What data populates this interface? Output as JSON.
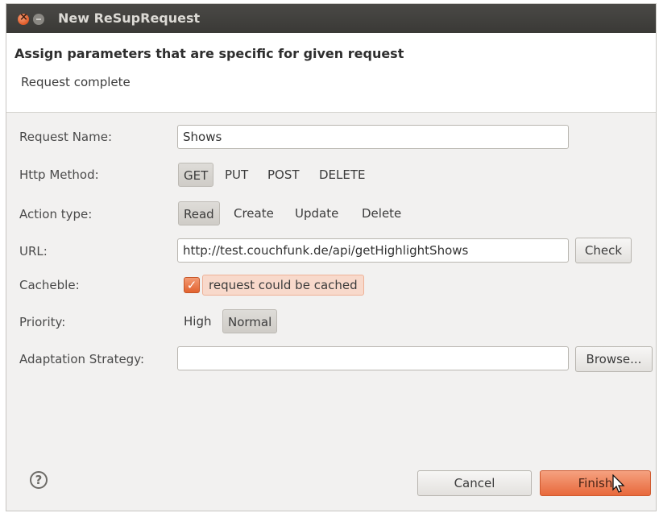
{
  "window": {
    "title": "New ReSupRequest"
  },
  "banner": {
    "title": "Assign parameters that are specific for given request",
    "message": "Request complete"
  },
  "form": {
    "request_name": {
      "label": "Request Name:",
      "value": "Shows"
    },
    "http_method": {
      "label": "Http Method:",
      "options": [
        "GET",
        "PUT",
        "POST",
        "DELETE"
      ],
      "selected": "GET"
    },
    "action_type": {
      "label": "Action type:",
      "options": [
        "Read",
        "Create",
        "Update",
        "Delete"
      ],
      "selected": "Read"
    },
    "url": {
      "label": "URL:",
      "value": "http://test.couchfunk.de/api/getHighlightShows",
      "check_label": "Check"
    },
    "cacheble": {
      "label": "Cacheble:",
      "checkbox_label": "request could be cached",
      "checked": true
    },
    "priority": {
      "label": "Priority:",
      "options": [
        "High",
        "Normal"
      ],
      "selected": "Normal"
    },
    "adaptation_strategy": {
      "label": "Adaptation Strategy:",
      "value": "",
      "browse_label": "Browse..."
    }
  },
  "footer": {
    "help_glyph": "?",
    "cancel_label": "Cancel",
    "finish_label": "Finish"
  },
  "colors": {
    "accent": "#e8693c",
    "title_bar": "#3f3e3b"
  }
}
